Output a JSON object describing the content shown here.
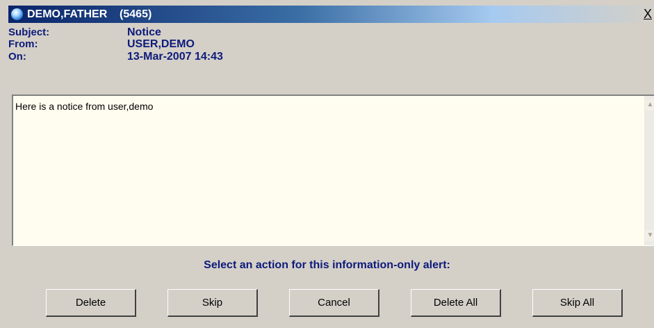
{
  "window": {
    "title": "DEMO,FATHER    (5465)",
    "close_label": "X"
  },
  "header": {
    "subject_label": "Subject:",
    "subject_value": "Notice",
    "from_label": "From:",
    "from_value": "USER,DEMO",
    "on_label": "On:",
    "on_value": "13-Mar-2007 14:43"
  },
  "message": {
    "text": "Here is a notice from user,demo"
  },
  "prompt": "Select an action for this information-only alert:",
  "buttons": {
    "delete": "Delete",
    "skip": "Skip",
    "cancel": "Cancel",
    "delete_all": "Delete All",
    "skip_all": "Skip All"
  },
  "icons": {
    "title": "app-globe-icon",
    "close": "close-icon",
    "scroll_up": "scroll-up-arrow-icon",
    "scroll_down": "scroll-down-arrow-icon"
  },
  "colors": {
    "titlebar_start": "#0a246a",
    "label_text": "#0d1a7a",
    "message_background": "#fffdf0",
    "window_background": "#d4d0c8"
  }
}
